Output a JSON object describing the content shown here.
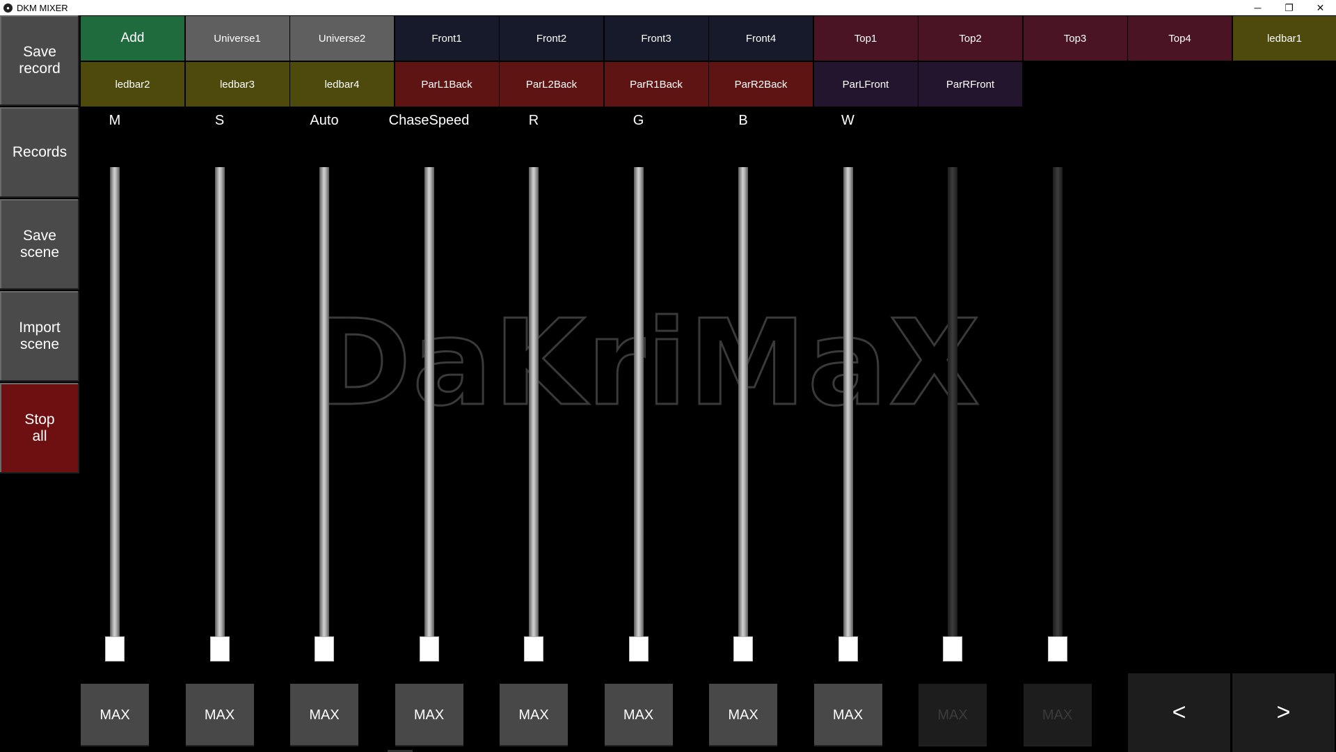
{
  "window": {
    "title": "DKM MIXER",
    "app_icon": "dkm-logo-icon",
    "minimize": "─",
    "restore": "❐",
    "close": "✕"
  },
  "sidebar": [
    {
      "label": "Save\nrecord",
      "color": "#4a4a4a"
    },
    {
      "label": "Records",
      "color": "#4a4a4a"
    },
    {
      "label": "Save\nscene",
      "color": "#4a4a4a"
    },
    {
      "label": "Import\nscene",
      "color": "#4a4a4a"
    },
    {
      "label": "Stop\nall",
      "color": "#6e0f11"
    }
  ],
  "groups_row1": [
    {
      "label": "Add",
      "color": "#1f6b3e"
    },
    {
      "label": "Universe1",
      "color": "#5f5f5f"
    },
    {
      "label": "Universe2",
      "color": "#5f5f5f"
    },
    {
      "label": "Front1",
      "color": "#171a2a"
    },
    {
      "label": "Front2",
      "color": "#171a2a"
    },
    {
      "label": "Front3",
      "color": "#171a2a"
    },
    {
      "label": "Front4",
      "color": "#171a2a"
    },
    {
      "label": "Top1",
      "color": "#4a1424"
    },
    {
      "label": "Top2",
      "color": "#4a1424"
    },
    {
      "label": "Top3",
      "color": "#4a1424"
    },
    {
      "label": "Top4",
      "color": "#4a1424"
    },
    {
      "label": "ledbar1",
      "color": "#4d4a0c"
    }
  ],
  "groups_row2": [
    {
      "label": "ledbar2",
      "color": "#4d4a0c"
    },
    {
      "label": "ledbar3",
      "color": "#4d4a0c"
    },
    {
      "label": "ledbar4",
      "color": "#4d4a0c"
    },
    {
      "label": "ParL1Back",
      "color": "#5e1412"
    },
    {
      "label": "ParL2Back",
      "color": "#5e1412"
    },
    {
      "label": "ParR1Back",
      "color": "#5e1412"
    },
    {
      "label": "ParR2Back",
      "color": "#5e1412"
    },
    {
      "label": "ParLFront",
      "color": "#24152f"
    },
    {
      "label": "ParRFront",
      "color": "#24152f"
    }
  ],
  "channels": [
    {
      "label": "M",
      "level": 0,
      "max_label": "MAX",
      "enabled": true
    },
    {
      "label": "S",
      "level": 0,
      "max_label": "MAX",
      "enabled": true
    },
    {
      "label": "Auto",
      "level": 0,
      "max_label": "MAX",
      "enabled": true
    },
    {
      "label": "ChaseSpeed",
      "level": 0,
      "max_label": "MAX",
      "enabled": true
    },
    {
      "label": "R",
      "level": 0,
      "max_label": "MAX",
      "enabled": true
    },
    {
      "label": "G",
      "level": 0,
      "max_label": "MAX",
      "enabled": true
    },
    {
      "label": "B",
      "level": 0,
      "max_label": "MAX",
      "enabled": true
    },
    {
      "label": "W",
      "level": 0,
      "max_label": "MAX",
      "enabled": true
    },
    {
      "label": "",
      "level": 0,
      "max_label": "MAX",
      "enabled": false
    },
    {
      "label": "",
      "level": 0,
      "max_label": "MAX",
      "enabled": false
    }
  ],
  "nav": {
    "prev": "<",
    "next": ">"
  },
  "watermark": "DaKriMaX"
}
